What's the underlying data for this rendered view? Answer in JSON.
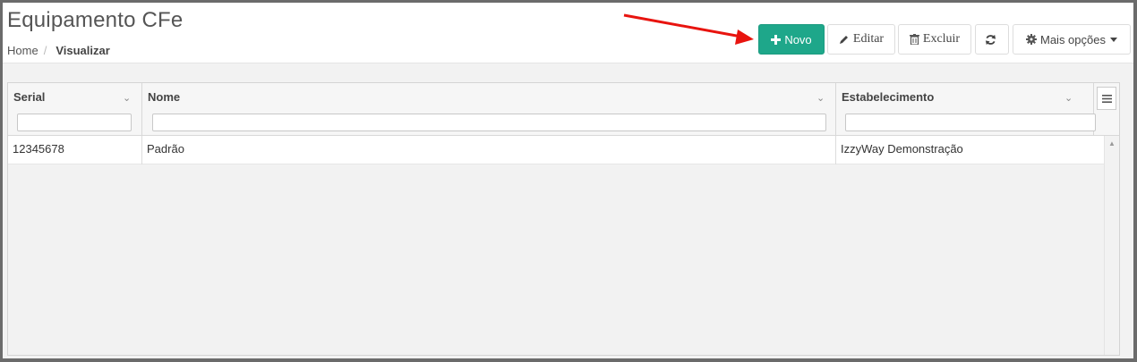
{
  "page": {
    "title": "Equipamento CFe",
    "breadcrumb": {
      "home": "Home",
      "separator": "/",
      "current": "Visualizar"
    }
  },
  "toolbar": {
    "new_label": "Novo",
    "edit_label": "Editar",
    "delete_label": "Excluir",
    "more_label": "Mais opções"
  },
  "grid": {
    "columns": [
      {
        "label": "Serial"
      },
      {
        "label": "Nome"
      },
      {
        "label": "Estabelecimento"
      }
    ],
    "rows": [
      {
        "serial": "12345678",
        "nome": "Padrão",
        "estabelecimento": "IzzyWay Demonstração"
      }
    ]
  },
  "colors": {
    "primary": "#1ea78a",
    "annotation_arrow": "#e8140f"
  }
}
